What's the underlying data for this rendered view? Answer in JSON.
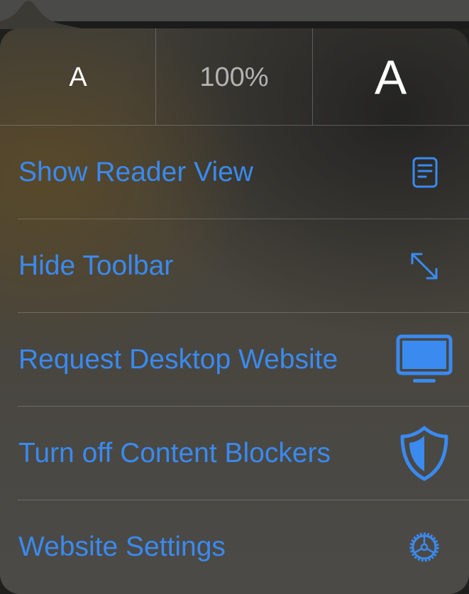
{
  "font_size_controls": {
    "decrease_label": "A",
    "zoom_level": "100%",
    "increase_label": "A"
  },
  "menu": {
    "items": [
      {
        "label": "Show Reader View",
        "icon": "reader-view-icon"
      },
      {
        "label": "Hide Toolbar",
        "icon": "expand-arrows-icon"
      },
      {
        "label": "Request Desktop Website",
        "icon": "desktop-monitor-icon"
      },
      {
        "label": "Turn off Content Blockers",
        "icon": "shield-icon"
      },
      {
        "label": "Website Settings",
        "icon": "gear-icon"
      }
    ]
  },
  "colors": {
    "accent": "#3a8af0",
    "text_primary": "#ffffff",
    "text_secondary": "#b3b3b3"
  }
}
